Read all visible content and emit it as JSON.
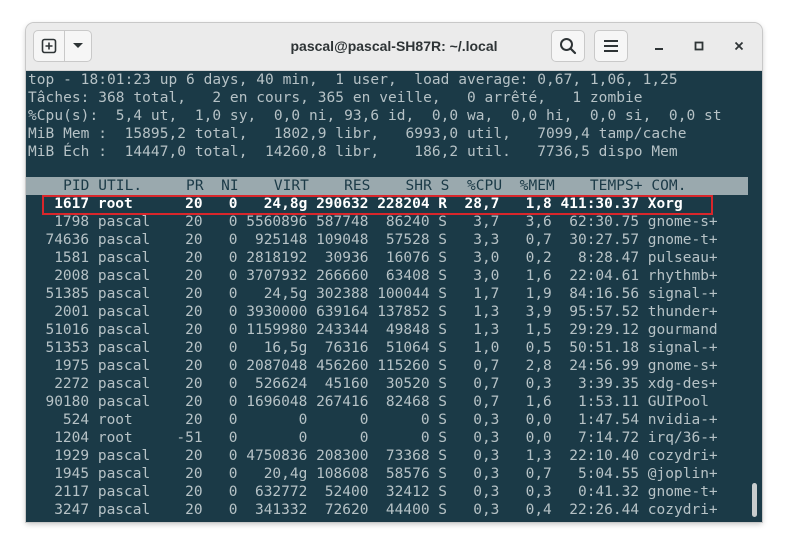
{
  "window": {
    "title": "pascal@pascal-SH87R: ~/.local"
  },
  "icons": {
    "new_tab": "new-tab-icon",
    "menu_dropdown": "chevron-down-icon",
    "search": "search-icon",
    "hamburger": "hamburger-menu-icon",
    "minimize": "minimize-icon",
    "maximize": "maximize-icon",
    "close": "close-icon"
  },
  "colors": {
    "terminal_bg": "#1b3a47",
    "terminal_fg": "#b6c2c6",
    "header_bg": "#9aa9ae",
    "highlight_border": "#d9262b"
  },
  "summary": [
    "top - 18:01:23 up 6 days, 40 min,  1 user,  load average: 0,67, 1,06, 1,25",
    "Tâches: 368 total,   2 en cours, 365 en veille,   0 arrêté,   1 zombie",
    "%Cpu(s):  5,4 ut,  1,0 sy,  0,0 ni, 93,6 id,  0,0 wa,  0,0 hi,  0,0 si,  0,0 st",
    "MiB Mem :  15895,2 total,   1802,9 libr,   6993,0 util,   7099,4 tamp/cache",
    "MiB Éch :  14447,0 total,  14260,8 libr,    186,2 util.   7736,5 dispo Mem"
  ],
  "table": {
    "header": "    PID UTIL.     PR  NI    VIRT    RES    SHR S  %CPU  %MEM    TEMPS+ COM.",
    "rows": [
      "   1617 root      20   0   24,8g 290632 228204 R  28,7   1,8 411:30.37 Xorg",
      "   1798 pascal    20   0 5560896 587748  86240 S   3,7   3,6  62:30.75 gnome-s+",
      "  74636 pascal    20   0  925148 109048  57528 S   3,3   0,7  30:27.57 gnome-t+",
      "   1581 pascal    20   0 2818192  30936  16076 S   3,0   0,2   8:28.47 pulseau+",
      "   2008 pascal    20   0 3707932 266660  63408 S   3,0   1,6  22:04.61 rhythmb+",
      "  51385 pascal    20   0   24,5g 302388 100044 S   1,7   1,9  84:16.56 signal-+",
      "   2001 pascal    20   0 3930000 639164 137852 S   1,3   3,9  95:57.52 thunder+",
      "  51016 pascal    20   0 1159980 243344  49848 S   1,3   1,5  29:29.12 gourmand",
      "  51353 pascal    20   0   16,5g  76316  51064 S   1,0   0,5  50:51.18 signal-+",
      "   1975 pascal    20   0 2087048 456260 115260 S   0,7   2,8  24:56.99 gnome-s+",
      "   2272 pascal    20   0  526624  45160  30520 S   0,7   0,3   3:39.35 xdg-des+",
      "  90180 pascal    20   0 1696048 267416  82468 S   0,7   1,6   1:53.11 GUIPool",
      "    524 root      20   0       0      0      0 S   0,3   0,0   1:47.54 nvidia-+",
      "   1204 root     -51   0       0      0      0 S   0,3   0,0   7:14.72 irq/36-+",
      "   1929 pascal    20   0 4750836 208300  73368 S   0,3   1,3  22:10.40 cozydri+",
      "   1945 pascal    20   0   20,4g 108608  58576 S   0,3   0,7   5:04.55 @joplin+",
      "   2117 pascal    20   0  632772  52400  32412 S   0,3   0,3   0:41.32 gnome-t+",
      "   3247 pascal    20   0  341332  72620  44400 S   0,3   0,4  22:26.44 cozydri+"
    ]
  }
}
